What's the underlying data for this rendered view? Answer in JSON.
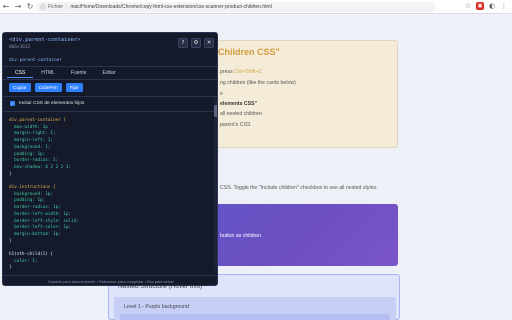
{
  "browser": {
    "back_glyph": "←",
    "forward_glyph": "→",
    "reload_glyph": "↻",
    "info_glyph": "ⓘ",
    "file_label": "Fichier",
    "url": "mac/Home/Downloads/Chrome/copy-html-css-extension/css-scanner-product-children.html",
    "star_glyph": "☆",
    "ext1_glyph": "▣",
    "ext2_glyph": "◐",
    "menu_glyph": "⋮"
  },
  "page": {
    "demo_title": "Children CSS\"",
    "line1_prefix": "press ",
    "line1_code": "Ctrl+Shift+C",
    "line2": "ng children (like the cards below)",
    "line3": "e",
    "line4": "elements CSS\"",
    "line5": "all nested children",
    "line6": "parent's CSS",
    "description": "CSS. Toggle the \"Include children\" checkbox to see all nested styles.",
    "purple_text": "button as children.",
    "nested_title": "Nested Structure (Hover this)",
    "level1_text": "Level 1 - Purple background"
  },
  "panel": {
    "selector": "<div.parent-container>",
    "size": "866×1632",
    "help_glyph": "?",
    "settings_glyph": "⚙",
    "close_glyph": "✕",
    "breadcrumb": "div.parent-container",
    "tabs": [
      "CSS",
      "HTML",
      "Fuente",
      "Editar"
    ],
    "active_tab": "CSS",
    "buttons": [
      "Copiar",
      "CodePen",
      "Fijar"
    ],
    "checkbox_checked": true,
    "checkbox_glyph": "✓",
    "checkbox_label": "Incluir CSS de elementos hijos",
    "code_lines": [
      {
        "t": "sel",
        "v": "div.parent-container {"
      },
      {
        "t": "prop",
        "v": "  max-width: 1p"
      },
      {
        "t": "prop",
        "v": "  margin-right: 1;"
      },
      {
        "t": "prop",
        "v": "  margin-left: 1;"
      },
      {
        "t": "prop",
        "v": "  background: 1;"
      },
      {
        "t": "prop",
        "v": "  padding: 1p;"
      },
      {
        "t": "prop",
        "v": "  border-radius: 1;"
      },
      {
        "t": "prop",
        "v": "  box-shadow: 0 2 2 2 3;"
      },
      {
        "t": "brace",
        "v": "}"
      },
      {
        "t": "brace",
        "v": ""
      },
      {
        "t": "sel",
        "v": "div.instructions {"
      },
      {
        "t": "prop",
        "v": "  background: 1p;"
      },
      {
        "t": "prop",
        "v": "  padding: 1p;"
      },
      {
        "t": "prop",
        "v": "  border-radius: 1p;"
      },
      {
        "t": "prop",
        "v": "  border-left-width: 1p;"
      },
      {
        "t": "prop",
        "v": "  border-left-style: solid;"
      },
      {
        "t": "prop",
        "v": "  border-left-color: 1p;"
      },
      {
        "t": "prop",
        "v": "  margin-bottom: 1p;"
      },
      {
        "t": "brace",
        "v": "}"
      },
      {
        "t": "brace",
        "v": ""
      },
      {
        "t": "brace",
        "v": "h1(nth-child(1) {"
      },
      {
        "t": "prop",
        "v": "  color: 1;"
      },
      {
        "t": "brace",
        "v": "}"
      }
    ],
    "footer": "Espacio para descomprimir • Retroceso para completar • Esc para cerrar"
  }
}
